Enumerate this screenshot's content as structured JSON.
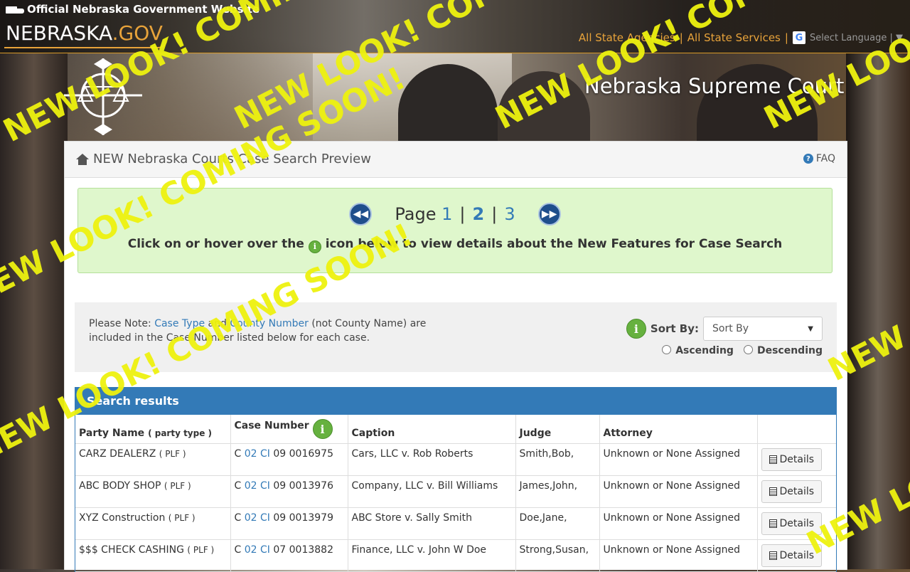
{
  "gov_bar": {
    "official_text": "Official Nebraska Government Website",
    "logo_main": "NEBRASKA",
    "logo_suffix": ".GOV",
    "links": [
      "All State Agencies",
      "All State Services"
    ],
    "language_label": "Select Language"
  },
  "court_title": "Nebraska Supreme Court",
  "panel": {
    "title": "NEW Nebraska Courts Case Search Preview",
    "faq": "FAQ"
  },
  "pager": {
    "label": "Page",
    "pages": [
      "1",
      "2",
      "3"
    ],
    "current": "2",
    "features_before": "Click on or hover over the",
    "features_after": "icon below to view details about the New Features for Case Search"
  },
  "note": {
    "prefix": "Please Note:",
    "case_type": "Case Type",
    "and": "and",
    "county_number": "County Number",
    "suffix": "(not County Name) are included in the Case Number listed below for each case."
  },
  "sort": {
    "label": "Sort By:",
    "selected": "Sort By",
    "ascending": "Ascending",
    "descending": "Descending"
  },
  "results": {
    "title": "Search results",
    "columns": {
      "party_name": "Party Name",
      "party_type": "( party type )",
      "case_number": "Case Number",
      "caption": "Caption",
      "judge": "Judge",
      "attorney": "Attorney"
    },
    "details_label": "Details",
    "rows": [
      {
        "party": "CARZ DEALERZ",
        "ptype": "( PLF )",
        "cn_prefix": "C",
        "cn_county": "02",
        "cn_type": "CI",
        "cn_rest": "09 0016975",
        "caption": "Cars, LLC v. Rob Roberts",
        "judge": "Smith,Bob,",
        "attorney": "Unknown or None Assigned"
      },
      {
        "party": "ABC BODY SHOP",
        "ptype": "( PLF )",
        "cn_prefix": "C",
        "cn_county": "02",
        "cn_type": "CI",
        "cn_rest": "09 0013976",
        "caption": "Company, LLC v. Bill Williams",
        "judge": "James,John,",
        "attorney": "Unknown or None Assigned"
      },
      {
        "party": "XYZ Construction",
        "ptype": "( PLF )",
        "cn_prefix": "C",
        "cn_county": "02",
        "cn_type": "CI",
        "cn_rest": "09 0013979",
        "caption": "ABC Store v. Sally Smith",
        "judge": "Doe,Jane,",
        "attorney": "Unknown or None Assigned"
      },
      {
        "party": "$$$ CHECK CASHING",
        "ptype": "( PLF )",
        "cn_prefix": "C",
        "cn_county": "02",
        "cn_type": "CI",
        "cn_rest": "07 0013882",
        "caption": "Finance, LLC v. John W Doe",
        "judge": "Strong,Susan,",
        "attorney": "Unknown or None Assigned"
      }
    ]
  },
  "watermark": "NEW LOOK! COMING SOON!",
  "colors": {
    "accent": "#337ab7",
    "gov_orange": "#e8a33a",
    "info_green": "#66b13f",
    "watermark": "#eef20f",
    "features_bg": "#dff7cc"
  }
}
